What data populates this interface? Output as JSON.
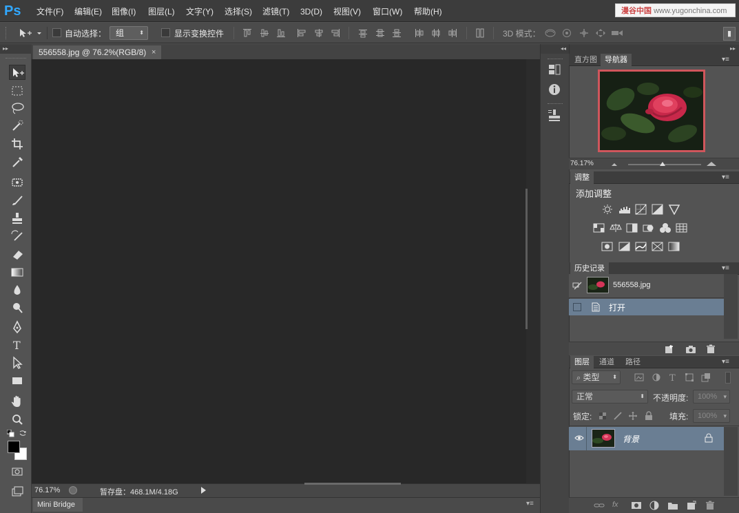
{
  "app": {
    "logo": "Ps",
    "menu": [
      "文件(F)",
      "编辑(E)",
      "图像(I)",
      "图层(L)",
      "文字(Y)",
      "选择(S)",
      "滤镜(T)",
      "3D(D)",
      "视图(V)",
      "窗口(W)",
      "帮助(H)"
    ],
    "watermark_brand": "漫谷中国",
    "watermark_url": "www.yugonchina.com"
  },
  "options": {
    "auto_select_label": "自动选择：",
    "auto_select_value": "组",
    "show_transform_label": "显示变换控件",
    "mode_3d_label": "3D 模式："
  },
  "document": {
    "tab_title": "556558.jpg @ 76.2%(RGB/8)",
    "zoom": "76.17%",
    "scratch_label": "暂存盘：468.1M/4.18G",
    "mini_bridge": "Mini Bridge"
  },
  "navigator": {
    "tabs": [
      "直方图",
      "导航器"
    ],
    "zoom": "76.17%"
  },
  "adjustments": {
    "tab": "调整",
    "title": "添加调整"
  },
  "history": {
    "tab": "历史记录",
    "snapshot": "556558.jpg",
    "items": [
      "打开"
    ]
  },
  "layers": {
    "tabs": [
      "图层",
      "通道",
      "路径"
    ],
    "filter_kind": "类型",
    "blend_mode": "正常",
    "opacity_label": "不透明度:",
    "opacity_value": "100%",
    "lock_label": "锁定:",
    "fill_label": "填充:",
    "fill_value": "100%",
    "layer_name": "背景"
  },
  "colors": {
    "ps_blue": "#31a8ff",
    "selection": "#6a7e93",
    "nav_frame": "#d0565c"
  }
}
